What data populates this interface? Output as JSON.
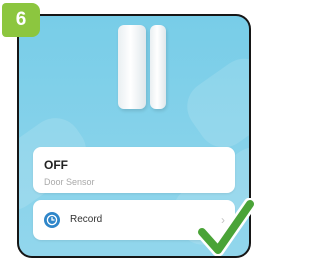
{
  "step": {
    "number": "6",
    "color": "#8cc63f"
  },
  "device": {
    "status": "OFF",
    "type_label": "Door Sensor",
    "image_icon": "door-window-sensor-icon"
  },
  "record": {
    "label": "Record",
    "icon": "clock-icon",
    "chevron": "›"
  },
  "overlay": {
    "icon": "checkmark-icon",
    "color": "#4aa337"
  },
  "colors": {
    "header_blue": "#78cde8",
    "frame": "#161616",
    "card": "#ffffff"
  }
}
